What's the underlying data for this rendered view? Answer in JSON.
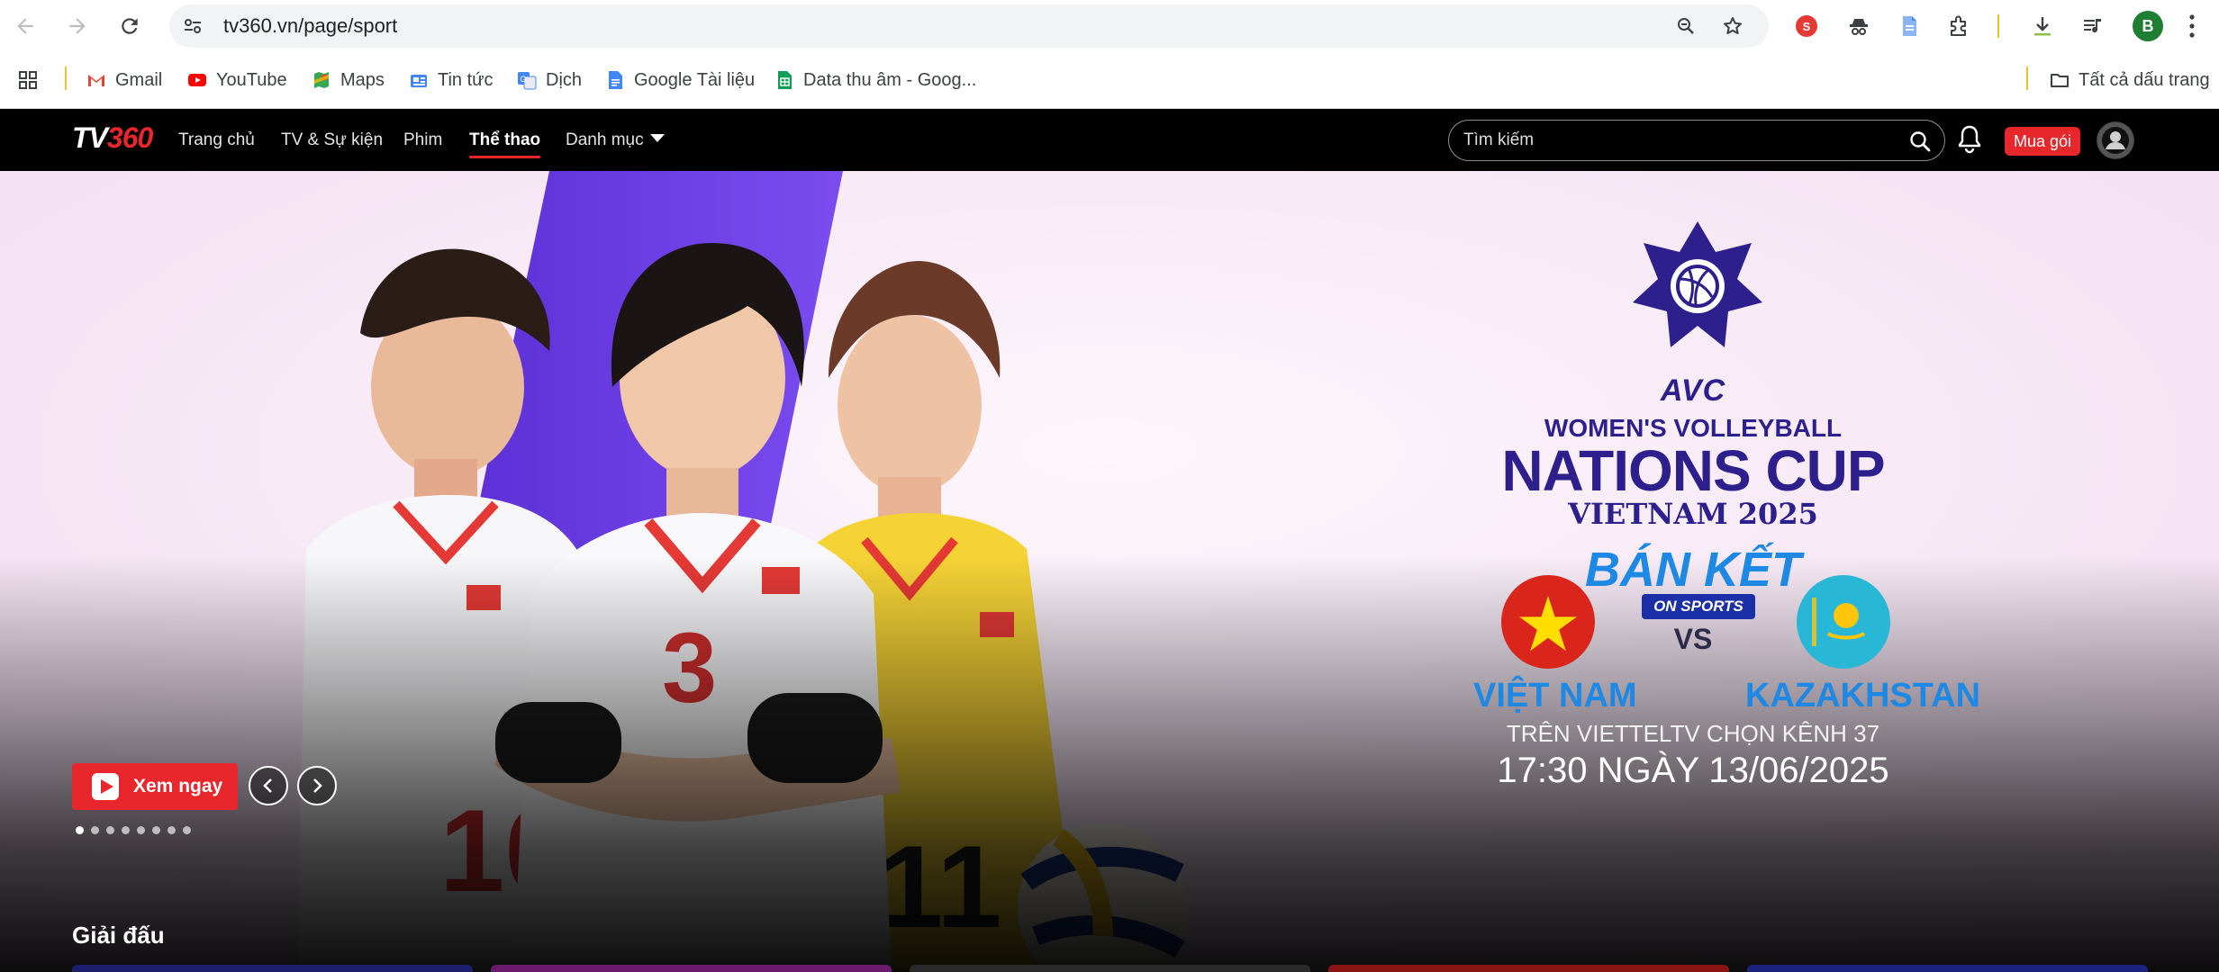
{
  "browser": {
    "url": "tv360.vn/page/sport",
    "bookmarks": [
      {
        "label": "Gmail",
        "icon": "gmail-icon"
      },
      {
        "label": "YouTube",
        "icon": "youtube-icon"
      },
      {
        "label": "Maps",
        "icon": "maps-icon"
      },
      {
        "label": "Tin tức",
        "icon": "news-icon"
      },
      {
        "label": "Dịch",
        "icon": "translate-icon"
      },
      {
        "label": "Google Tài liệu",
        "icon": "docs-icon"
      },
      {
        "label": "Data thu âm - Goog...",
        "icon": "sheets-icon"
      }
    ],
    "all_bookmarks": "Tất cả dấu trang",
    "profile_initial": "B"
  },
  "site": {
    "logo_tv": "TV",
    "logo_num": "360",
    "nav": [
      {
        "label": "Trang chủ",
        "active": false
      },
      {
        "label": "TV & Sự kiện",
        "active": false
      },
      {
        "label": "Phim",
        "active": false
      },
      {
        "label": "Thể thao",
        "active": true
      },
      {
        "label": "Danh mục",
        "active": false
      }
    ],
    "search_placeholder": "Tìm kiếm",
    "buy_label": "Mua gói"
  },
  "hero": {
    "brand": "AVC",
    "title_line1": "WOMEN'S VOLLEYBALL",
    "title_line2": "NATIONS CUP",
    "title_line3": "VIETNAM 2025",
    "round": "BÁN KẾT",
    "broadcaster": "ON SPORTS",
    "vs": "VS",
    "team_home": "VIỆT NAM",
    "team_away": "KAZAKHSTAN",
    "channel": "TRÊN VIETTELTV CHỌN KÊNH 37",
    "time": "17:30 NGÀY 13/06/2025",
    "jersey_numbers": [
      "10",
      "3",
      "11"
    ],
    "watch_label": "Xem ngay",
    "slide_count": 8,
    "active_slide": 0
  },
  "section": {
    "title": "Giải đấu",
    "tile_colors": [
      "#1b1f6e",
      "#6a1b6e",
      "#2a2a2a",
      "#8a1414",
      "#1a237e"
    ]
  },
  "colors": {
    "accent": "#e8272c",
    "avc_navy": "#2d1f8c",
    "avc_blue": "#1e88e5",
    "header_bg": "#000000"
  }
}
